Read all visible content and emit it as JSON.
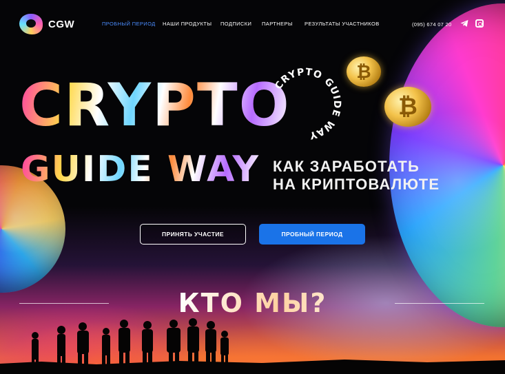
{
  "header": {
    "logo_text": "CGW",
    "nav": [
      "ПРОБНЫЙ ПЕРИОД",
      "НАШИ ПРОДУКТЫ",
      "ПОДПИСКИ",
      "ПАРТНЕРЫ",
      "РЕЗУЛЬТАТЫ УЧАСТНИКОВ"
    ],
    "phone": "(095) 674 07 20",
    "social_icons": [
      "telegram-icon",
      "instagram-icon"
    ]
  },
  "hero": {
    "title_line1": "CRYPTO",
    "title_line2": "GUIDE WAY",
    "badge_text": "CRYPTO GUIDE WAY",
    "subtitle_line1": "КАК ЗАРАБОТАТЬ",
    "subtitle_line2": "НА КРИПТОВАЛЮТЕ",
    "coin_symbol": "₿"
  },
  "buttons": {
    "participate": "ПРИНЯТЬ УЧАСТИЕ",
    "trial": "ПРОБНЫЙ ПЕРИОД"
  },
  "section": {
    "title": "КТО МЫ?"
  },
  "colors": {
    "accent": "#1a73e8",
    "nav_active": "#4b8dff",
    "background": "#050507"
  }
}
